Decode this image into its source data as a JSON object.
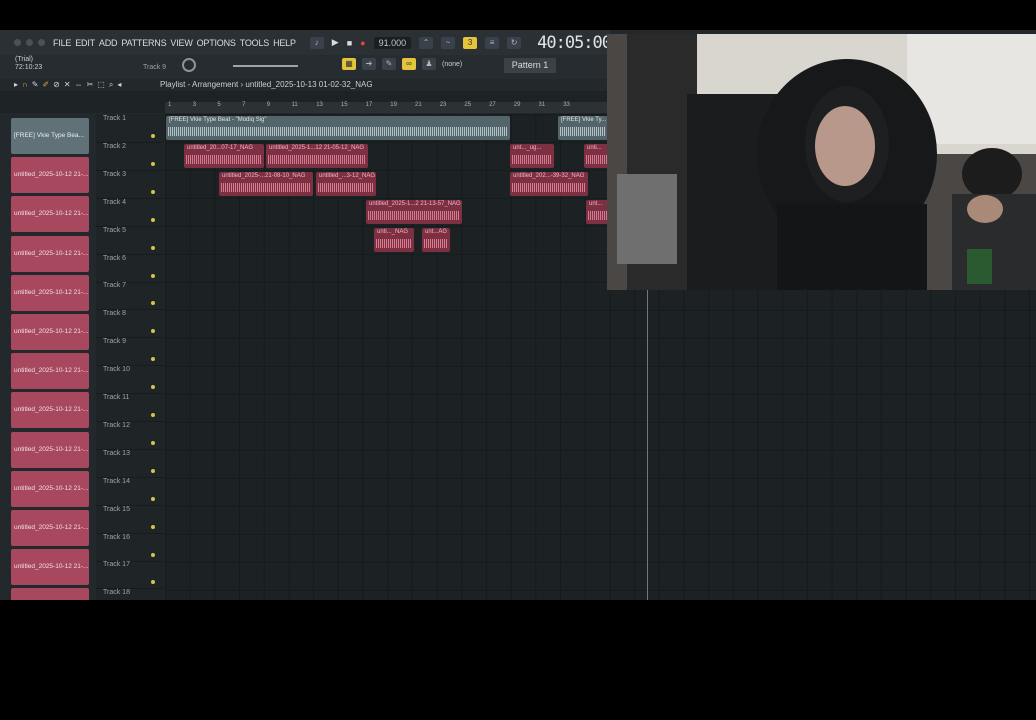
{
  "menubar": {
    "items": [
      "FILE",
      "EDIT",
      "ADD",
      "PATTERNS",
      "VIEW",
      "OPTIONS",
      "TOOLS",
      "HELP"
    ],
    "tempo": "91.000",
    "time": "40:05:00",
    "play_symbol": "▶",
    "stop_symbol": "■",
    "record_symbol": "●"
  },
  "toolbar2": {
    "trial": "(Trial)",
    "trial_time": "72:10:23",
    "track_label": "Track 9",
    "none_label": "(none)",
    "pattern": "Pattern 1"
  },
  "playlist": {
    "title": "Playlist - Arrangement",
    "file": "untitled_2025-10-13 01-02-32_NAG",
    "ruler": [
      "1",
      "3",
      "5",
      "7",
      "9",
      "11",
      "13",
      "15",
      "17",
      "19",
      "21",
      "23",
      "25",
      "27",
      "29",
      "31",
      "33"
    ]
  },
  "channels": [
    "[FREE] Vkie Type Bea...",
    "untitled_2025-10-12 21-...",
    "untitled_2025-10-12 21-...",
    "untitled_2025-10-12 21-...",
    "untitled_2025-10-12 21-...",
    "untitled_2025-10-12 21-...",
    "untitled_2025-10-12 21-...",
    "untitled_2025-10-12 21-...",
    "untitled_2025-10-12 21-...",
    "untitled_2025-10-12 21-...",
    "untitled_2025-10-12 21-...",
    "untitled_2025-10-12 21-...",
    "untitled_2025-10-12 21-...",
    "untitled_2025-10-12 21-..."
  ],
  "tracks": [
    "Track 1",
    "Track 2",
    "Track 3",
    "Track 4",
    "Track 5",
    "Track 6",
    "Track 7",
    "Track 8",
    "Track 9",
    "Track 10",
    "Track 11",
    "Track 12",
    "Track 13",
    "Track 14",
    "Track 15",
    "Track 16",
    "Track 17",
    "Track 18"
  ],
  "clips": {
    "beat": "[FREE] Vkie Type Beat - \"Modiq Sig\"",
    "beat2": "[FREE] Vkie Ty...",
    "t2a": "untitled_20...07-17_NAG",
    "t2b": "untitled_2025-1...12 21-05-12_NAG",
    "t2c": "unt..._ug...",
    "t2d": "unti...",
    "t3a": "untitled_2025-...21-08-10_NAG",
    "t3b": "untitled_...3-12_NAG",
    "t3c": "untitled_202...-39-32_NAG",
    "t4a": "untitled_2025-1...2 21-13-57_NAG",
    "t4b": "unt...",
    "t5a": "unti..._NAG",
    "t5b": "unt...AG"
  }
}
